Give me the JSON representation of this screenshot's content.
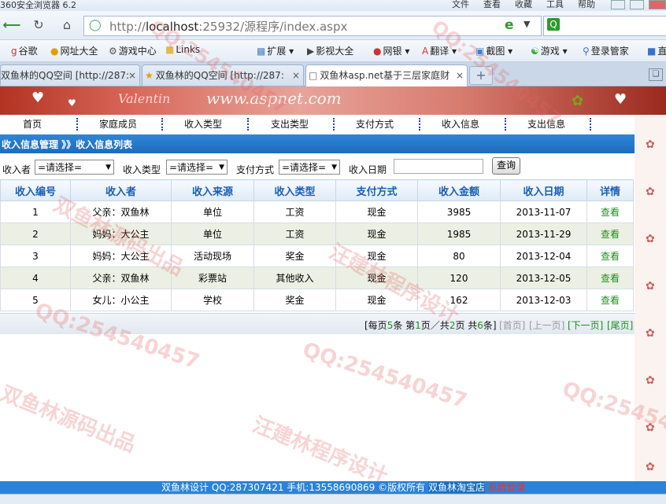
{
  "browser": {
    "title": "360安全浏览器 6.2",
    "menu": [
      "文件",
      "查看",
      "收藏",
      "工具",
      "帮助"
    ],
    "url_prefix": "http://",
    "url_host": "localhost",
    "url_rest": ":25932/源程序/index.aspx",
    "bookmarks": [
      {
        "label": "谷歌",
        "icon": "google-icon"
      },
      {
        "label": "网址大全",
        "icon": "site-nav-icon"
      },
      {
        "label": "游戏中心",
        "icon": "gamepad-icon"
      },
      {
        "label": "Links",
        "icon": "folder-icon"
      },
      {
        "label": "扩展",
        "icon": "extension-icon"
      },
      {
        "label": "影视大全",
        "icon": "video-icon"
      },
      {
        "label": "网银",
        "icon": "bank-icon"
      },
      {
        "label": "翻译",
        "icon": "translate-icon"
      },
      {
        "label": "截图",
        "icon": "screenshot-icon"
      },
      {
        "label": "游戏",
        "icon": "game-icon"
      },
      {
        "label": "登录管家",
        "icon": "key-icon"
      },
      {
        "label": "直",
        "icon": "direct-icon"
      }
    ],
    "tabs": [
      {
        "label": "双鱼林的QQ空间 [http://287:"
      },
      {
        "label": "双鱼林的QQ空间 [http://287:"
      },
      {
        "label": "双鱼林asp.net基于三层家庭财"
      }
    ]
  },
  "site": {
    "logo": "www.aspnet.com",
    "banner_text": "Valentin",
    "nav": [
      "首页",
      "家庭成员",
      "收入类型",
      "支出类型",
      "支付方式",
      "收入信息",
      "支出信息"
    ],
    "breadcrumb": "收入信息管理 》》收入信息列表"
  },
  "filters": {
    "receiver_label": "收入者",
    "receiver_value": "=请选择=",
    "type_label": "收入类型",
    "type_value": "=请选择=",
    "pay_label": "支付方式",
    "pay_value": "=请选择=",
    "date_label": "收入日期",
    "date_value": "",
    "query_label": "查询"
  },
  "table": {
    "headers": [
      "收入编号",
      "收入者",
      "收入来源",
      "收入类型",
      "支付方式",
      "收入金额",
      "收入日期",
      "详情"
    ],
    "rows": [
      [
        "1",
        "父亲：双鱼林",
        "单位",
        "工资",
        "现金",
        "3985",
        "2013-11-07",
        "查看"
      ],
      [
        "2",
        "妈妈：大公主",
        "单位",
        "工资",
        "现金",
        "1985",
        "2013-11-29",
        "查看"
      ],
      [
        "3",
        "妈妈：大公主",
        "活动现场",
        "奖金",
        "现金",
        "80",
        "2013-12-04",
        "查看"
      ],
      [
        "4",
        "父亲：双鱼林",
        "彩票站",
        "其他收入",
        "现金",
        "120",
        "2013-12-05",
        "查看"
      ],
      [
        "5",
        "女儿：小公主",
        "学校",
        "奖金",
        "现金",
        "162",
        "2013-12-03",
        "查看"
      ]
    ]
  },
  "pager": {
    "per_page_a": "[每页",
    "per_page_n": "5",
    "per_page_b": "条 第",
    "cur_page": "1",
    "pages_a": "页／共",
    "total_pages": "2",
    "pages_b": "页 共",
    "total_items": "6",
    "items_b": "条]",
    "first": "[首页]",
    "prev": "[上一页]",
    "next": "[下一页]",
    "last": "[尾页]"
  },
  "watermarks": [
    "QQ:254540457",
    "双鱼林源码出品",
    "汪建林程序设计"
  ],
  "footer": {
    "text": "双鱼林设计 QQ:287307421 手机:13558690869 ©版权所有",
    "shop": "双鱼林淘宝店",
    "login": "系统登录"
  }
}
